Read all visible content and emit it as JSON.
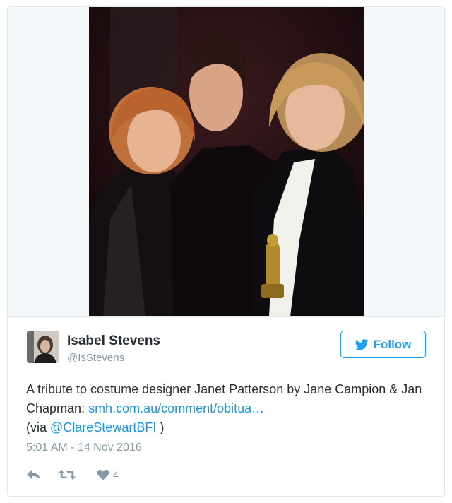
{
  "user": {
    "name": "Isabel Stevens",
    "handle": "@IsStevens",
    "avatar_icon": "profile-photo"
  },
  "follow_button": {
    "label": "Follow",
    "icon": "twitter-bird-icon",
    "color": "#1da1f2"
  },
  "tweet": {
    "text_before": "A tribute to costume designer Janet Patterson by Jane Campion & Jan Chapman: ",
    "link": "smh.com.au/comment/obitua…",
    "text_mid": " (via ",
    "mention": "@ClareStewartBFI",
    "text_after": " )",
    "link_color": "#1b95e0"
  },
  "timestamp": "5:01 AM - 14 Nov 2016",
  "actions": {
    "reply_icon": "reply-icon",
    "retweet_icon": "retweet-icon",
    "like_icon": "heart-icon",
    "like_count": "4"
  },
  "media": {
    "type": "photo",
    "icon": "photo-three-women"
  }
}
